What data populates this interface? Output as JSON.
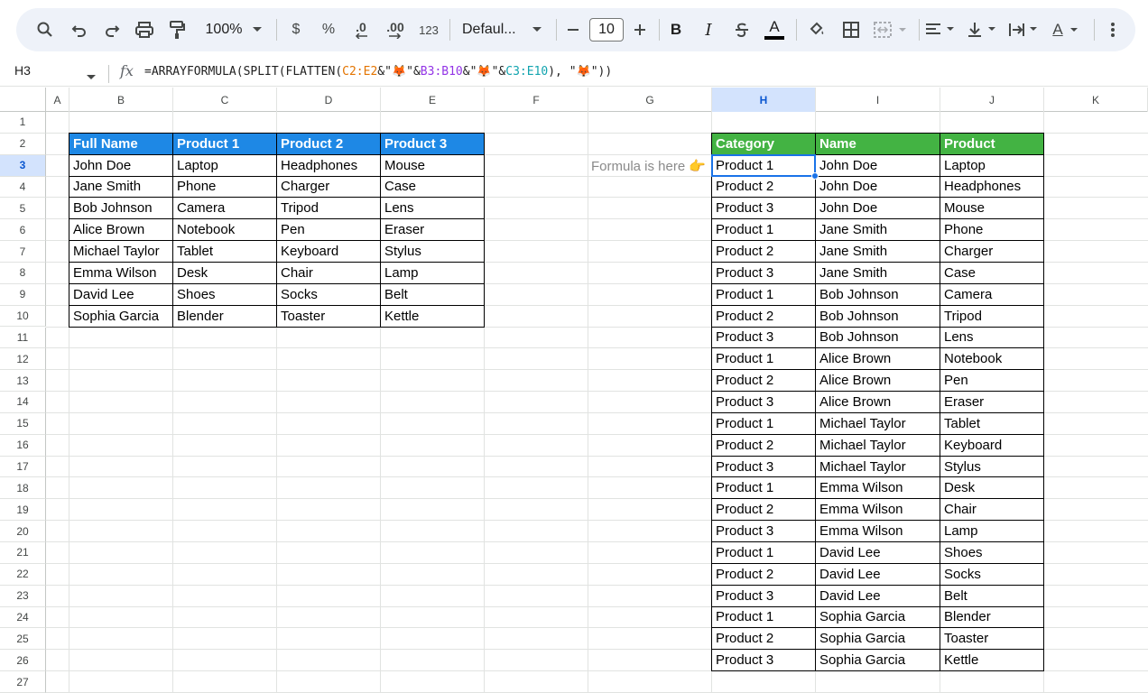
{
  "toolbar": {
    "zoom": "100%",
    "currency": "$",
    "percent": "%",
    "dec_decrease": ".0",
    "dec_increase": ".00",
    "number_format": "123",
    "font": "Defaul...",
    "font_size": "10",
    "bold": "B",
    "italic": "I",
    "text_color_letter": "A",
    "text_color_letter2": "A",
    "icons": [
      "search-icon",
      "undo-icon",
      "redo-icon",
      "print-icon",
      "paint-format-icon",
      "chevron-down-icon",
      "minus-icon",
      "plus-icon",
      "strikethrough-icon",
      "fill-color-icon",
      "borders-icon",
      "merge-cells-icon",
      "align-left-icon",
      "vertical-align-icon",
      "text-wrap-icon",
      "more-vert-icon"
    ]
  },
  "formula_bar": {
    "name_box": "H3",
    "fx": "fx",
    "formula_parts": [
      {
        "t": "=ARRAYFORMULA(SPLIT(FLATTEN(",
        "c": ""
      },
      {
        "t": "C2:E2",
        "c": "r1"
      },
      {
        "t": "&\"🦊\"&",
        "c": ""
      },
      {
        "t": "B3:B10",
        "c": "r2"
      },
      {
        "t": "&\"🦊\"&",
        "c": ""
      },
      {
        "t": "C3:E10",
        "c": "r3"
      },
      {
        "t": "), \"🦊\"))",
        "c": ""
      }
    ]
  },
  "columns": [
    "A",
    "B",
    "C",
    "D",
    "E",
    "F",
    "G",
    "H",
    "I",
    "J",
    "K"
  ],
  "rows": [
    1,
    2,
    3,
    4,
    5,
    6,
    7,
    8,
    9,
    10,
    11,
    12,
    13,
    14,
    15,
    16,
    17,
    18,
    19,
    20,
    21,
    22,
    23,
    24,
    25,
    26,
    27
  ],
  "selected_cell": {
    "col": "H",
    "row": 3
  },
  "note": "Formula is here 👉",
  "source_table": {
    "headers": [
      "Full Name",
      "Product 1",
      "Product 2",
      "Product 3"
    ],
    "header_color": "#1e88e5",
    "rows": [
      [
        "John Doe",
        "Laptop",
        "Headphones",
        "Mouse"
      ],
      [
        "Jane Smith",
        "Phone",
        "Charger",
        "Case"
      ],
      [
        "Bob Johnson",
        "Camera",
        "Tripod",
        "Lens"
      ],
      [
        "Alice Brown",
        "Notebook",
        "Pen",
        "Eraser"
      ],
      [
        "Michael Taylor",
        "Tablet",
        "Keyboard",
        "Stylus"
      ],
      [
        "Emma Wilson",
        "Desk",
        "Chair",
        "Lamp"
      ],
      [
        "David Lee",
        "Shoes",
        "Socks",
        "Belt"
      ],
      [
        "Sophia Garcia",
        "Blender",
        "Toaster",
        "Kettle"
      ]
    ]
  },
  "result_table": {
    "headers": [
      "Category",
      "Name",
      "Product"
    ],
    "header_color": "#43b343",
    "rows": [
      [
        "Product 1",
        "John Doe",
        "Laptop"
      ],
      [
        "Product 2",
        "John Doe",
        "Headphones"
      ],
      [
        "Product 3",
        "John Doe",
        "Mouse"
      ],
      [
        "Product 1",
        "Jane Smith",
        "Phone"
      ],
      [
        "Product 2",
        "Jane Smith",
        "Charger"
      ],
      [
        "Product 3",
        "Jane Smith",
        "Case"
      ],
      [
        "Product 1",
        "Bob Johnson",
        "Camera"
      ],
      [
        "Product 2",
        "Bob Johnson",
        "Tripod"
      ],
      [
        "Product 3",
        "Bob Johnson",
        "Lens"
      ],
      [
        "Product 1",
        "Alice Brown",
        "Notebook"
      ],
      [
        "Product 2",
        "Alice Brown",
        "Pen"
      ],
      [
        "Product 3",
        "Alice Brown",
        "Eraser"
      ],
      [
        "Product 1",
        "Michael Taylor",
        "Tablet"
      ],
      [
        "Product 2",
        "Michael Taylor",
        "Keyboard"
      ],
      [
        "Product 3",
        "Michael Taylor",
        "Stylus"
      ],
      [
        "Product 1",
        "Emma Wilson",
        "Desk"
      ],
      [
        "Product 2",
        "Emma Wilson",
        "Chair"
      ],
      [
        "Product 3",
        "Emma Wilson",
        "Lamp"
      ],
      [
        "Product 1",
        "David Lee",
        "Shoes"
      ],
      [
        "Product 2",
        "David Lee",
        "Socks"
      ],
      [
        "Product 3",
        "David Lee",
        "Belt"
      ],
      [
        "Product 1",
        "Sophia Garcia",
        "Blender"
      ],
      [
        "Product 2",
        "Sophia Garcia",
        "Toaster"
      ],
      [
        "Product 3",
        "Sophia Garcia",
        "Kettle"
      ]
    ]
  }
}
